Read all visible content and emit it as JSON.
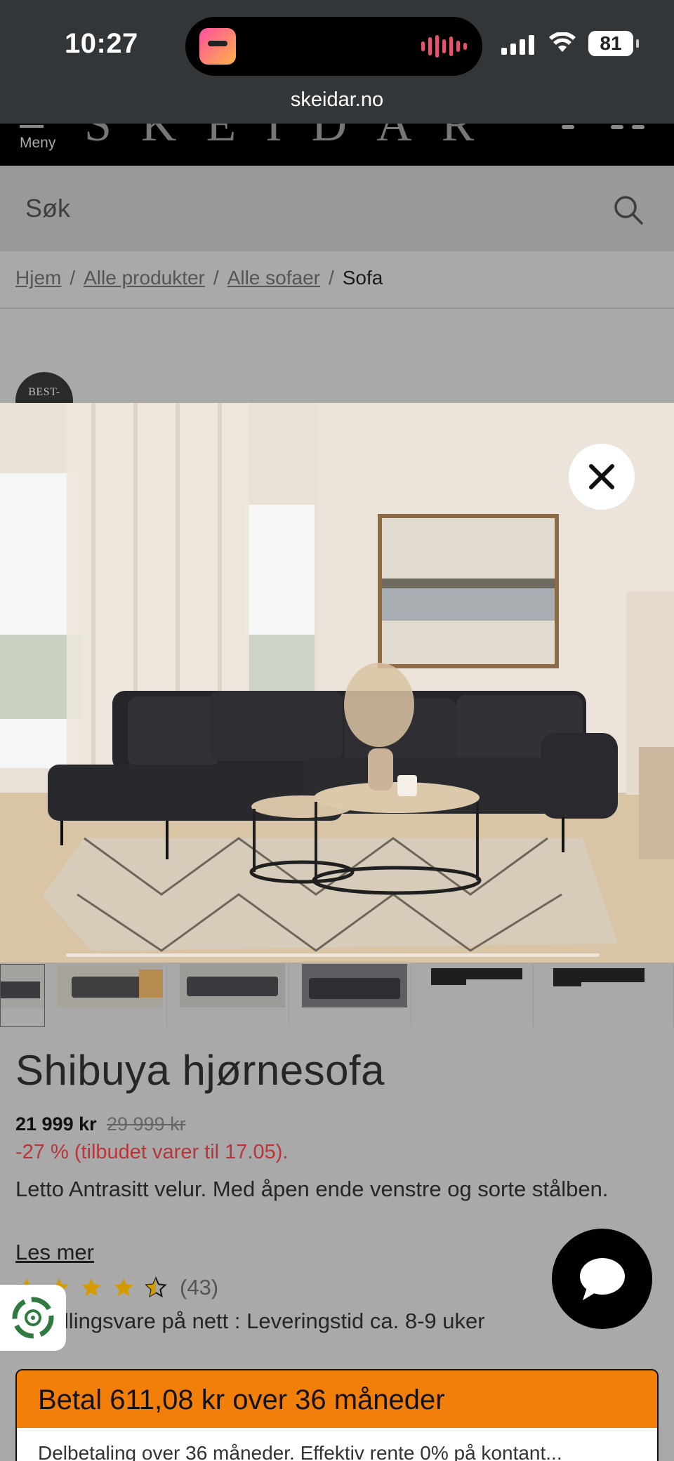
{
  "status_bar": {
    "time": "10:27",
    "battery": "81",
    "url": "skeidar.no"
  },
  "header": {
    "menu_label": "Meny"
  },
  "search": {
    "placeholder": "Søk"
  },
  "breadcrumb": {
    "items": [
      "Hjem",
      "Alle produkter",
      "Alle sofaer"
    ],
    "separator": "/",
    "current": "Sofa"
  },
  "badge": {
    "label": "BEST-"
  },
  "product": {
    "title": "Shibuya hjørnesofa",
    "price": "21 999 kr",
    "old_price": "29 999 kr",
    "discount": "-27 % (tilbudet varer til 17.05).",
    "description": "Letto Antrasitt velur. Med åpen ende venstre og sorte stålben.",
    "read_more": "Les mer",
    "rating": 4.5,
    "review_count": "(43)",
    "delivery": "Bestillingsvare på nett : Leveringstid ca. 8-9 uker"
  },
  "financing": {
    "headline": "Betal 611,08 kr over 36 måneder",
    "detail": "Delbetaling over 36 måneder. Effektiv rente 0% på kontant..."
  },
  "colors": {
    "accent_orange": "#f17f0a",
    "discount_red": "#b8363a",
    "star_gold": "#d49b00",
    "overlay": "#a9a9a9"
  },
  "icons": {
    "search": "search-icon",
    "close": "close-icon",
    "chat": "chat-icon",
    "recycle": "recycle-icon"
  }
}
